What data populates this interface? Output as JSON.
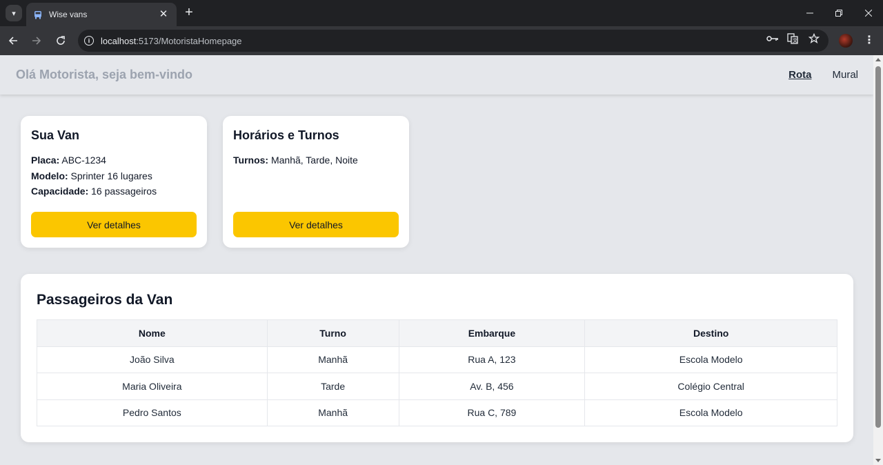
{
  "browser": {
    "tab_title": "Wise vans",
    "url_host": "localhost",
    "url_path": ":5173/MotoristaHomepage"
  },
  "header": {
    "greeting": "Olá Motorista, seja bem-vindo",
    "nav": [
      "Rota",
      "Mural"
    ]
  },
  "van_card": {
    "title": "Sua Van",
    "placa_label": "Placa:",
    "placa_value": " ABC-1234",
    "modelo_label": "Modelo:",
    "modelo_value": " Sprinter 16 lugares",
    "capacidade_label": "Capacidade:",
    "capacidade_value": " 16 passageiros",
    "button": "Ver detalhes"
  },
  "schedule_card": {
    "title": "Horários e Turnos",
    "turnos_label": "Turnos:",
    "turnos_value": " Manhã, Tarde, Noite",
    "button": "Ver detalhes"
  },
  "passengers": {
    "title": "Passageiros da Van",
    "columns": [
      "Nome",
      "Turno",
      "Embarque",
      "Destino"
    ],
    "rows": [
      [
        "João Silva",
        "Manhã",
        "Rua A, 123",
        "Escola Modelo"
      ],
      [
        "Maria Oliveira",
        "Tarde",
        "Av. B, 456",
        "Colégio Central"
      ],
      [
        "Pedro Santos",
        "Manhã",
        "Rua C, 789",
        "Escola Modelo"
      ]
    ]
  },
  "colors": {
    "accent": "#fbc600",
    "page_bg": "#e5e7eb"
  },
  "icons": [
    "tab-search-icon",
    "van-favicon",
    "close-icon",
    "plus-icon",
    "minimize-icon",
    "restore-icon",
    "close-window-icon",
    "back-arrow-icon",
    "forward-arrow-icon",
    "reload-icon",
    "info-icon",
    "key-icon",
    "translate-icon",
    "star-icon",
    "profile-avatar",
    "kebab-menu-icon"
  ]
}
